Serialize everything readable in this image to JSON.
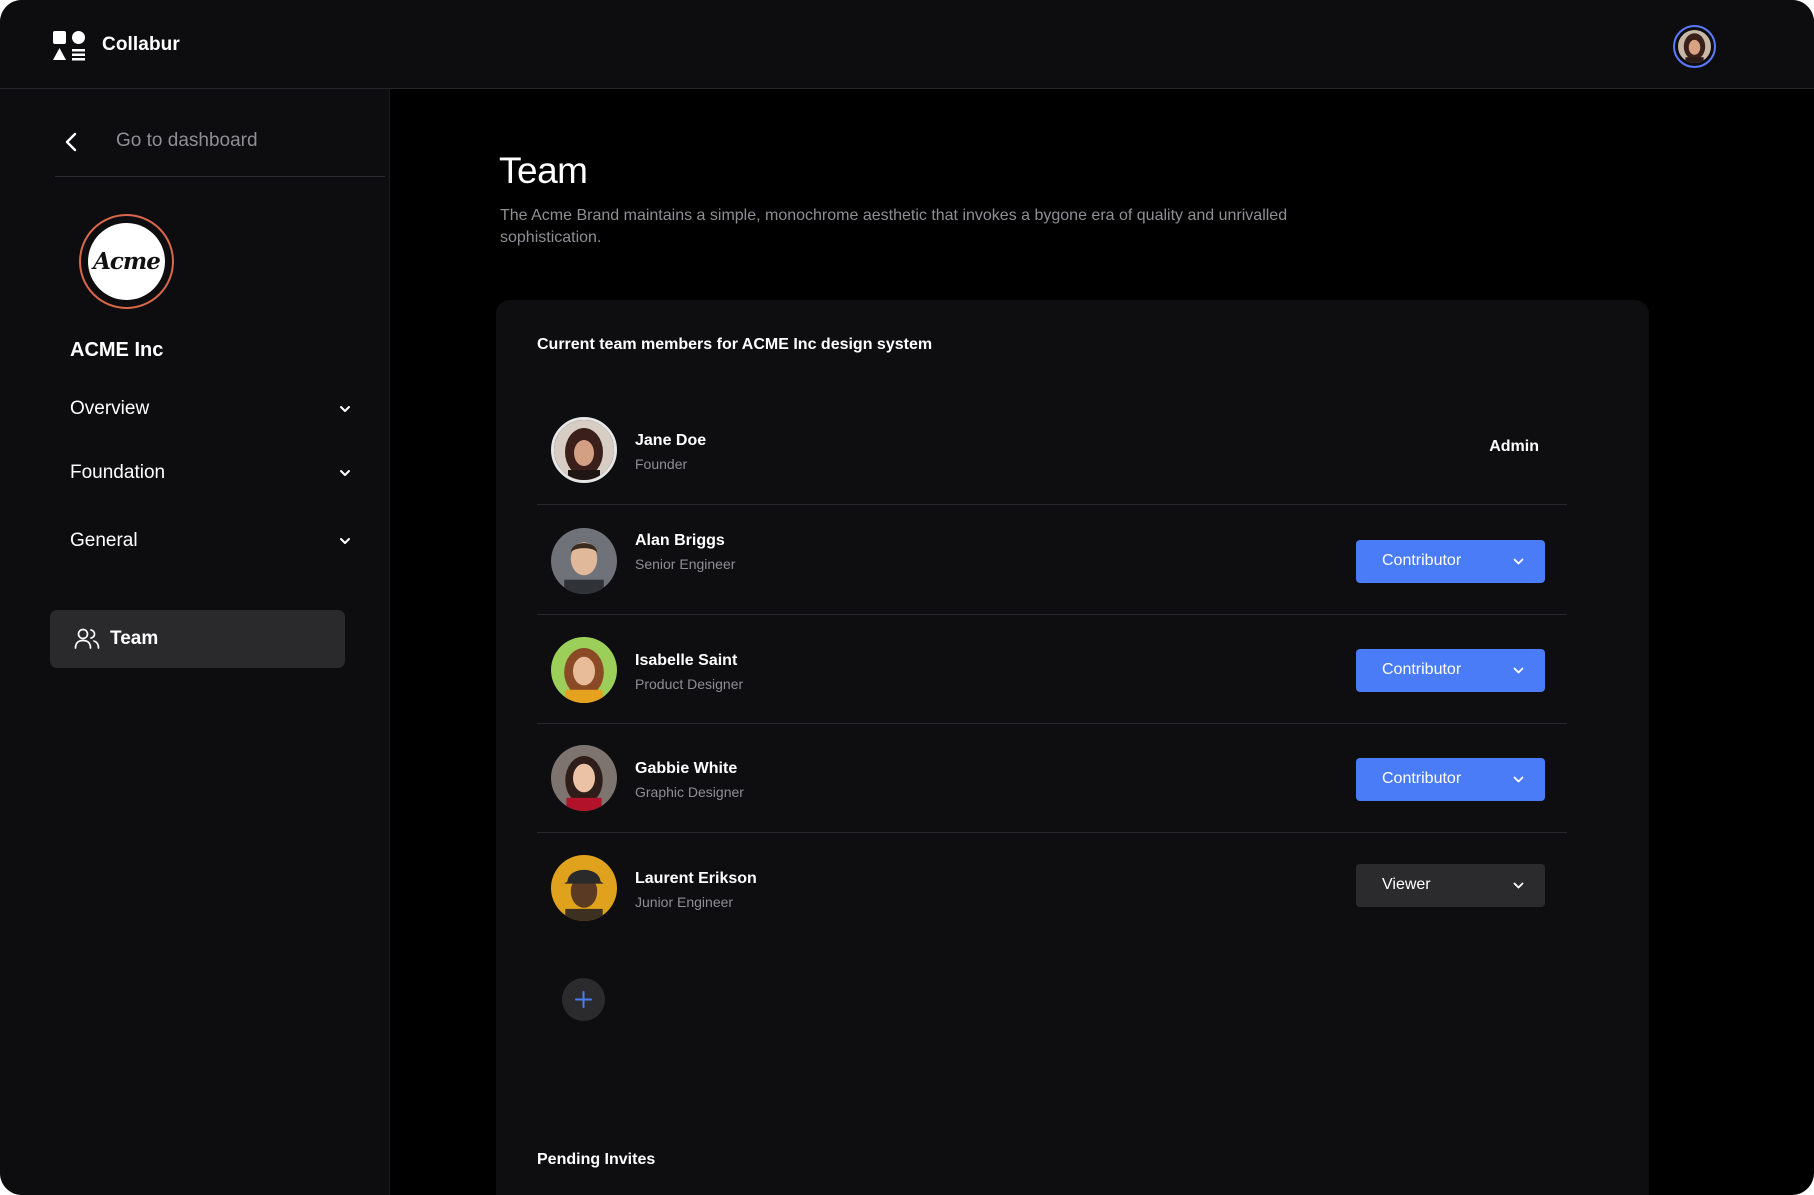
{
  "app": {
    "name": "Collabur"
  },
  "sidebar": {
    "back_label": "Go to dashboard",
    "org_logo_text": "Acme",
    "org_name": "ACME Inc",
    "nav": [
      {
        "label": "Overview"
      },
      {
        "label": "Foundation"
      },
      {
        "label": "General"
      }
    ],
    "active_item": {
      "label": "Team"
    }
  },
  "main": {
    "title": "Team",
    "description": "The Acme Brand maintains a simple, monochrome aesthetic that invokes a bygone era of quality and unrivalled sophistication.",
    "members_heading": "Current team members for ACME Inc design system",
    "members": [
      {
        "name": "Jane Doe",
        "role": "Founder",
        "permission": "Admin"
      },
      {
        "name": "Alan Briggs",
        "role": "Senior Engineer",
        "permission": "Contributor"
      },
      {
        "name": "Isabelle Saint",
        "role": "Product Designer",
        "permission": "Contributor"
      },
      {
        "name": "Gabbie White",
        "role": "Graphic Designer",
        "permission": "Contributor"
      },
      {
        "name": "Laurent Erikson",
        "role": "Junior Engineer",
        "permission": "Viewer"
      }
    ],
    "pending_heading": "Pending Invites"
  },
  "colors": {
    "accent": "#4a7cf7",
    "background": "#000000",
    "panel": "#0d0d0f",
    "card": "#0e0e10",
    "muted_text": "#8e8e94"
  }
}
